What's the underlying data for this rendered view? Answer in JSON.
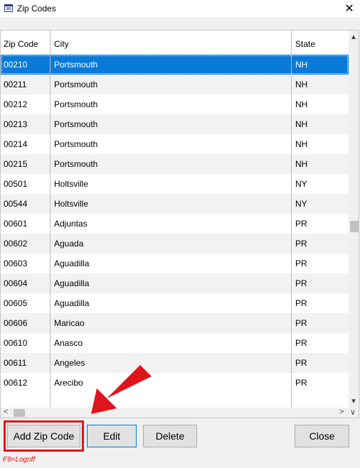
{
  "window": {
    "title": "Zip Codes",
    "close_icon": "close-icon"
  },
  "grid": {
    "columns": [
      "Zip Code",
      "City",
      "State"
    ],
    "rows": [
      {
        "zip": "00210",
        "city": "Portsmouth",
        "state": "NH",
        "selected": true
      },
      {
        "zip": "00211",
        "city": "Portsmouth",
        "state": "NH"
      },
      {
        "zip": "00212",
        "city": "Portsmouth",
        "state": "NH"
      },
      {
        "zip": "00213",
        "city": "Portsmouth",
        "state": "NH"
      },
      {
        "zip": "00214",
        "city": "Portsmouth",
        "state": "NH"
      },
      {
        "zip": "00215",
        "city": "Portsmouth",
        "state": "NH"
      },
      {
        "zip": "00501",
        "city": "Holtsville",
        "state": "NY"
      },
      {
        "zip": "00544",
        "city": "Holtsville",
        "state": "NY"
      },
      {
        "zip": "00601",
        "city": "Adjuntas",
        "state": "PR"
      },
      {
        "zip": "00602",
        "city": "Aguada",
        "state": "PR"
      },
      {
        "zip": "00603",
        "city": "Aguadilla",
        "state": "PR"
      },
      {
        "zip": "00604",
        "city": "Aguadilla",
        "state": "PR"
      },
      {
        "zip": "00605",
        "city": "Aguadilla",
        "state": "PR"
      },
      {
        "zip": "00606",
        "city": "Maricao",
        "state": "PR"
      },
      {
        "zip": "00610",
        "city": "Anasco",
        "state": "PR"
      },
      {
        "zip": "00611",
        "city": "Angeles",
        "state": "PR"
      },
      {
        "zip": "00612",
        "city": "Arecibo",
        "state": "PR"
      }
    ]
  },
  "buttons": {
    "add": "Add Zip Code",
    "edit": "Edit",
    "delete": "Delete",
    "close": "Close"
  },
  "hint": "F9=Logoff",
  "colors": {
    "selection": "#0a7ad9",
    "highlight": "#e0141c",
    "hint": "#d21414"
  }
}
